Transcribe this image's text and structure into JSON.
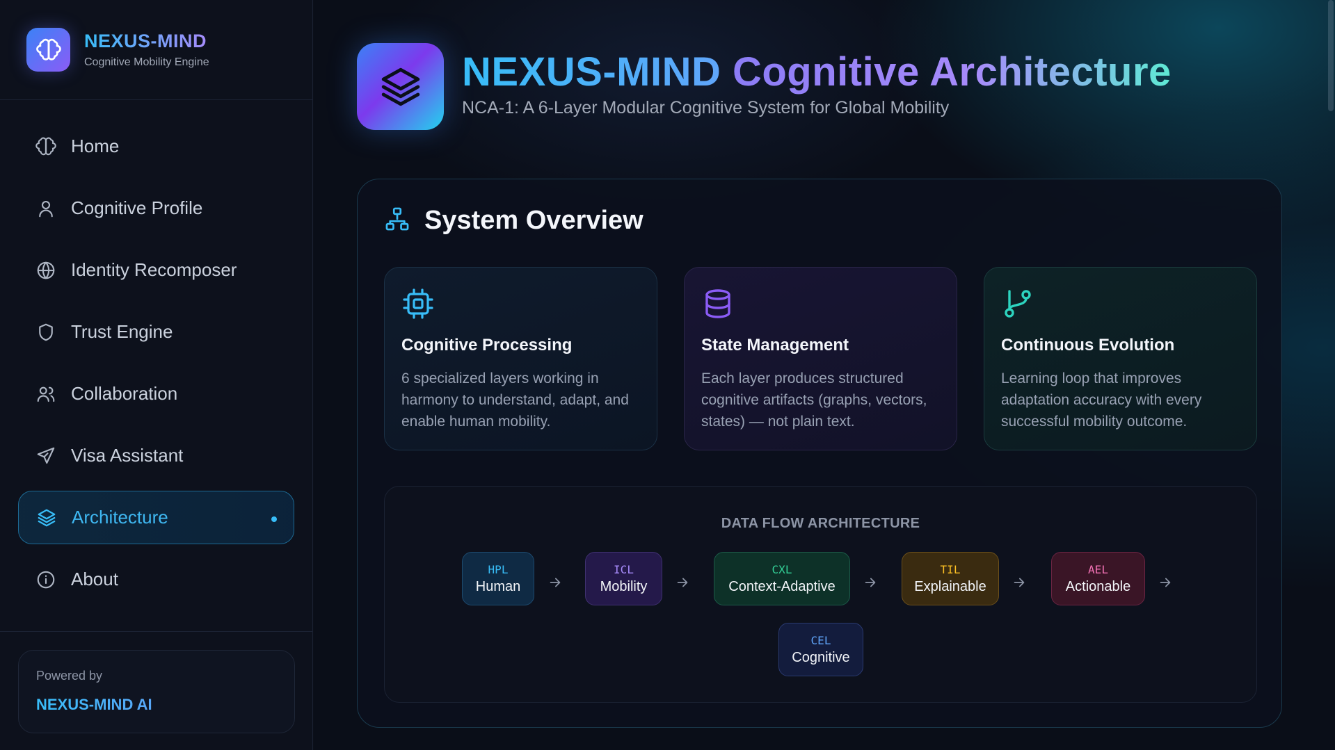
{
  "brand": {
    "title": "NEXUS-MIND",
    "subtitle": "Cognitive Mobility Engine",
    "icon": "brain-icon"
  },
  "sidebar": {
    "items": [
      {
        "label": "Home",
        "icon": "brain-icon",
        "active": false
      },
      {
        "label": "Cognitive Profile",
        "icon": "user-icon",
        "active": false
      },
      {
        "label": "Identity Recomposer",
        "icon": "globe-icon",
        "active": false
      },
      {
        "label": "Trust Engine",
        "icon": "shield-icon",
        "active": false
      },
      {
        "label": "Collaboration",
        "icon": "users-icon",
        "active": false
      },
      {
        "label": "Visa Assistant",
        "icon": "plane-icon",
        "active": false
      },
      {
        "label": "Architecture",
        "icon": "layers-icon",
        "active": true
      },
      {
        "label": "About",
        "icon": "info-icon",
        "active": false
      }
    ],
    "footer": {
      "label": "Powered by",
      "name": "NEXUS-MIND AI"
    }
  },
  "header": {
    "title_part1": "NEXUS-MIND",
    "title_part2": "Cognitive Architecture",
    "subtitle": "NCA-1: A 6-Layer Modular Cognitive System for Global Mobility",
    "icon": "layers-icon"
  },
  "overview": {
    "title": "System Overview",
    "icon": "network-icon",
    "cards": [
      {
        "title": "Cognitive Processing",
        "body": "6 specialized layers working in harmony to understand, adapt, and enable human mobility.",
        "icon": "cpu-icon"
      },
      {
        "title": "State Management",
        "body": "Each layer produces structured cognitive artifacts (graphs, vectors, states) — not plain text.",
        "icon": "database-icon"
      },
      {
        "title": "Continuous Evolution",
        "body": "Learning loop that improves adaptation accuracy with every successful mobility outcome.",
        "icon": "git-branch-icon"
      }
    ],
    "flow": {
      "title": "DATA FLOW ARCHITECTURE",
      "nodes": [
        {
          "code": "HPL",
          "name": "Human"
        },
        {
          "code": "ICL",
          "name": "Mobility"
        },
        {
          "code": "CXL",
          "name": "Context-Adaptive"
        },
        {
          "code": "TIL",
          "name": "Explainable"
        },
        {
          "code": "AEL",
          "name": "Actionable"
        },
        {
          "code": "CEL",
          "name": "Cognitive"
        }
      ]
    }
  },
  "colors": {
    "accent": "#38bdf8",
    "violet": "#a78bfa",
    "background": "#0b0f19"
  }
}
